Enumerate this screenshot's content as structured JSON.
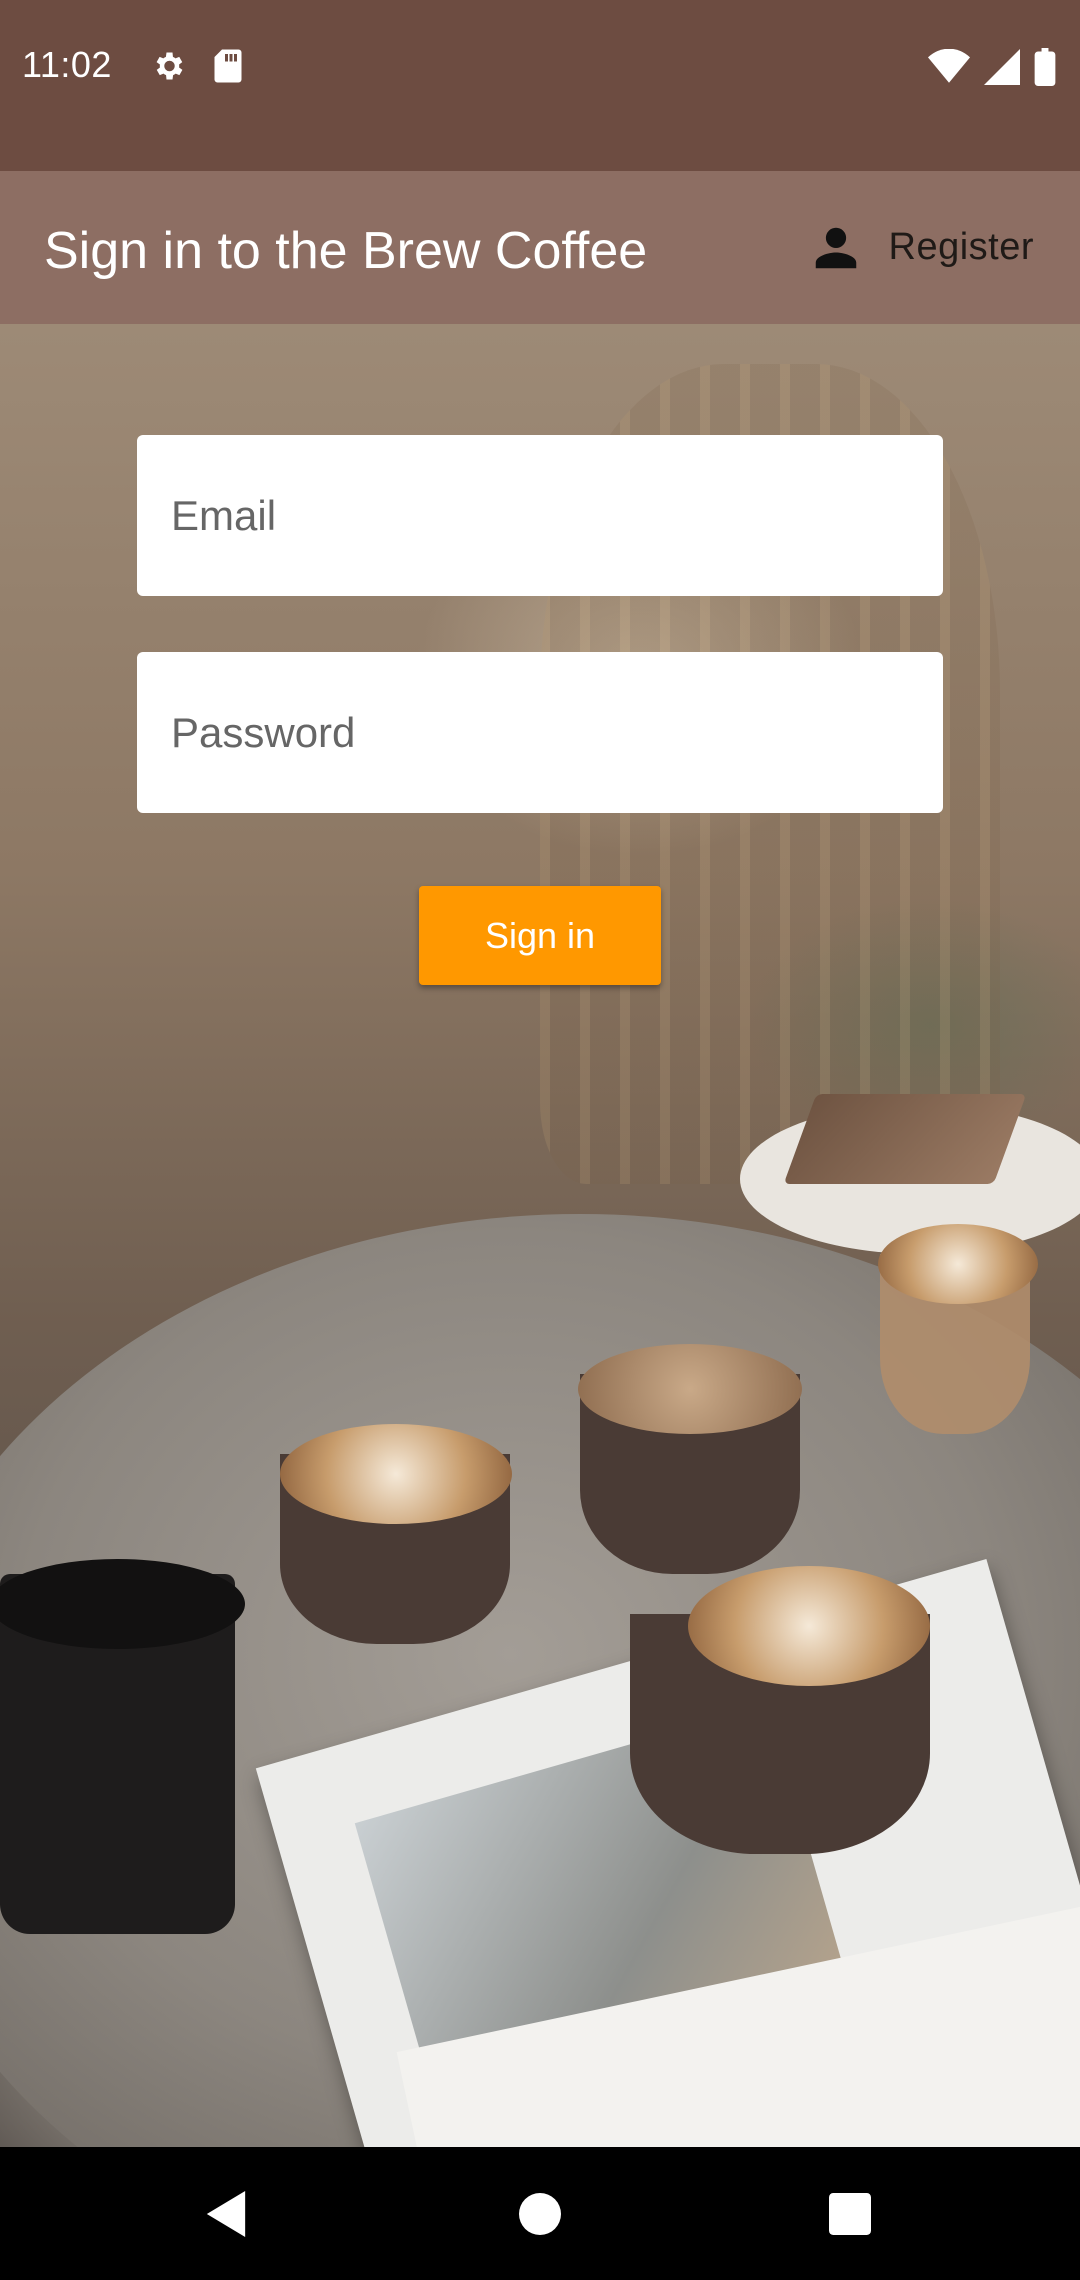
{
  "status_bar": {
    "time": "11:02",
    "left_icons": [
      "gear-icon",
      "sd-card-icon"
    ],
    "right_icons": [
      "wifi-icon",
      "cellular-signal-icon",
      "battery-icon"
    ]
  },
  "app_bar": {
    "title": "Sign in to the Brew Coffee",
    "register_label": "Register",
    "register_icon": "person-icon",
    "background_color": "#8d6e63"
  },
  "form": {
    "email_placeholder": "Email",
    "email_value": "",
    "password_placeholder": "Password",
    "password_value": "",
    "signin_label": "Sign in",
    "signin_color": "#ff9800"
  },
  "colors": {
    "status_bar": "#6d4c41",
    "accent": "#ff9800"
  },
  "nav_bar": {
    "buttons": [
      "back-icon",
      "home-icon",
      "recents-icon"
    ]
  }
}
